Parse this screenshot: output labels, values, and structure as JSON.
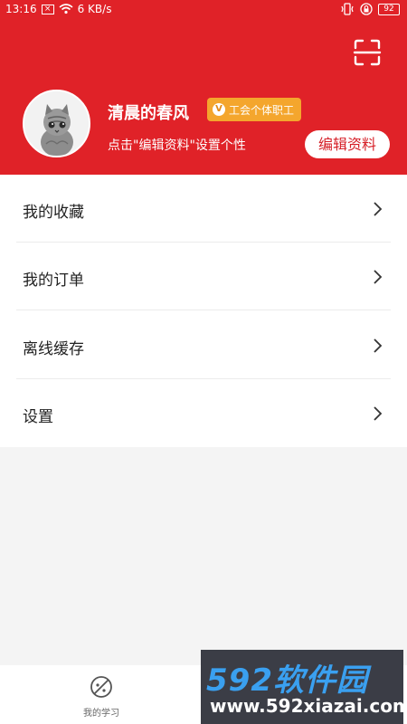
{
  "status": {
    "time": "13:16",
    "speed": "6 KB/s",
    "battery": "92"
  },
  "profile": {
    "username": "清晨的春风",
    "badge_icon": "V",
    "badge": "工会个体职工",
    "hint": "点击\"编辑资料\"设置个性",
    "edit_label": "编辑资料"
  },
  "menu": [
    {
      "label": "我的收藏"
    },
    {
      "label": "我的订单"
    },
    {
      "label": "离线缓存"
    },
    {
      "label": "设置"
    }
  ],
  "tabbar": {
    "study_label": "我的学习"
  },
  "watermark": {
    "title": "592软件园",
    "url": "www.592xiazai.com"
  },
  "colors": {
    "header": "#e02228",
    "badge": "#f4a62d",
    "page_bg": "#f4f4f4"
  },
  "icons": {
    "scan": "scan-icon",
    "chevron": "chevron-right-icon",
    "study": "study-icon"
  }
}
